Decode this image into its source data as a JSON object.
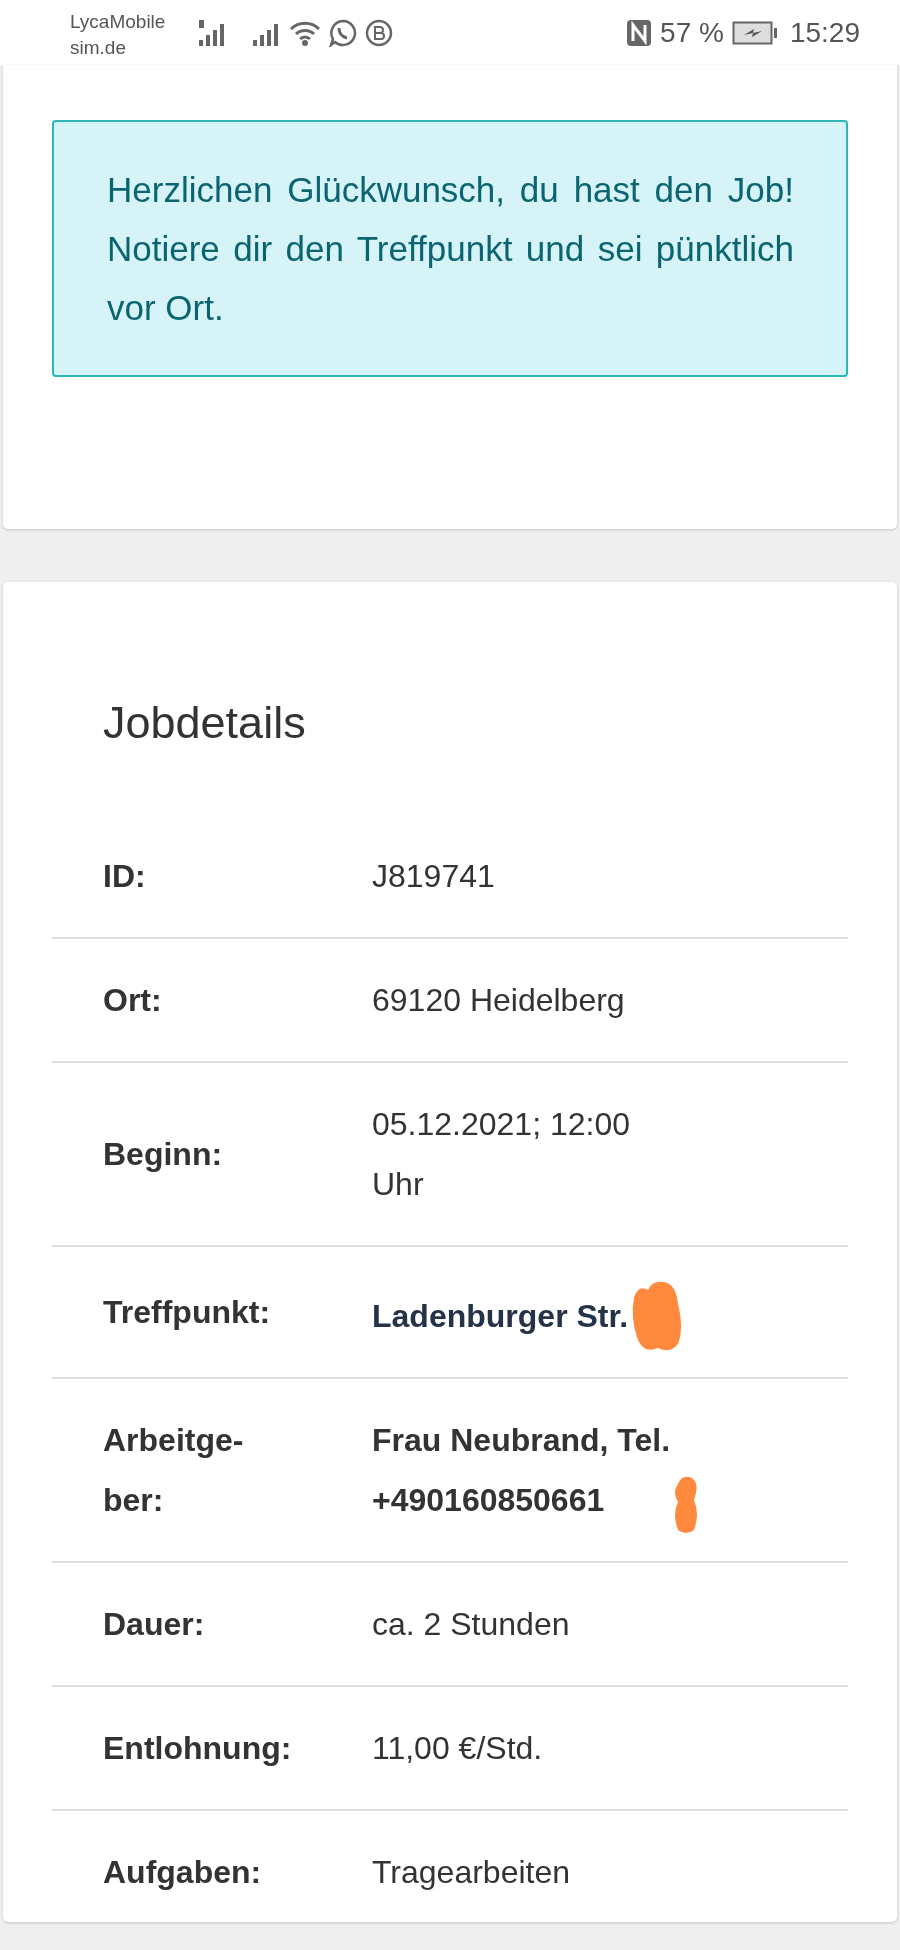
{
  "status_bar": {
    "carrier": [
      "LycaMobile",
      "sim.de"
    ],
    "battery": "57 %",
    "time": "15:29"
  },
  "alert": {
    "text": "Herzlichen Glückwunsch, du hast den Job! Notiere dir den Treffpunkt und sei pünktlich vor Ort."
  },
  "job_details": {
    "title": "Jobdetails",
    "rows": [
      {
        "label": "ID:",
        "value": "J819741",
        "kind": "text",
        "redacted": false
      },
      {
        "label": "Ort:",
        "value": "69120 Heidelberg",
        "kind": "text",
        "redacted": false
      },
      {
        "label": "Beginn:",
        "value": "05.12.2021; 12:00\nUhr",
        "kind": "text",
        "redacted": false
      },
      {
        "label": "Treffpunkt:",
        "value": "Ladenburger Str.",
        "kind": "link",
        "redacted": true
      },
      {
        "label": "Arbeitge-\nber:",
        "value": "Frau Neubrand, Tel.\n+490160850661",
        "kind": "bold",
        "redacted": true
      },
      {
        "label": "Dauer:",
        "value": "ca. 2 Stunden",
        "kind": "text",
        "redacted": false
      },
      {
        "label": "Entlohnung:",
        "value": "11,00 €/Std.",
        "kind": "text",
        "redacted": false
      },
      {
        "label": "Aufgaben:",
        "value": "Tragearbeiten",
        "kind": "text",
        "redacted": false
      }
    ]
  }
}
